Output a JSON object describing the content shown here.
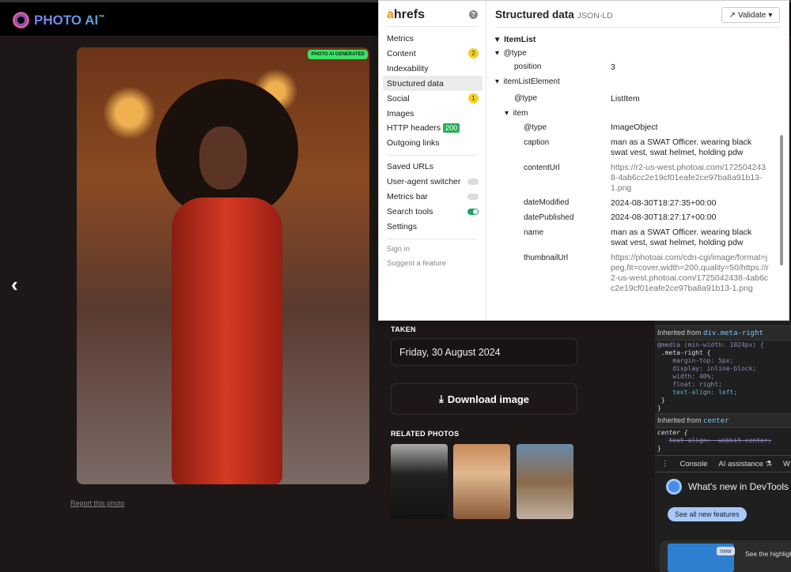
{
  "site": {
    "logo": "PHOTO AI",
    "tm": "™",
    "generated_badge": "PHOTO AI GENERATED",
    "report_link": "Report this photo",
    "taken_label": "TAKEN",
    "taken_value": "Friday, 30 August 2024",
    "download_label": "Download image",
    "related_label": "RELATED PHOTOS"
  },
  "ahrefs": {
    "brand_a": "a",
    "brand_rest": "hrefs",
    "help": "?",
    "nav": [
      {
        "label": "Metrics"
      },
      {
        "label": "Content",
        "badge": "2"
      },
      {
        "label": "Indexability"
      },
      {
        "label": "Structured data"
      },
      {
        "label": "Social",
        "badge": "1"
      },
      {
        "label": "Images"
      },
      {
        "label": "HTTP headers",
        "badge": "200"
      },
      {
        "label": "Outgoing links"
      }
    ],
    "tools": [
      {
        "label": "Saved URLs"
      },
      {
        "label": "User-agent switcher",
        "on": false
      },
      {
        "label": "Metrics bar",
        "on": false
      },
      {
        "label": "Search tools",
        "on": true
      },
      {
        "label": "Settings"
      }
    ],
    "footer": [
      "Sign in",
      "Suggest a feature"
    ],
    "title": "Structured data",
    "subtitle": "JSON-LD",
    "validate": "Validate",
    "tree": {
      "root": "ItemList",
      "type_key": "@type",
      "position_key": "position",
      "position_val": "3",
      "ile": "itemListElement",
      "ile_type": "ListItem",
      "item": "item",
      "item_type": "ImageObject",
      "caption_key": "caption",
      "caption": "man as a SWAT Officer. wearing black swat vest, swat helmet, holding pdw",
      "contentUrl_key": "contentUrl",
      "contentUrl": "https://r2-us-west.photoai.com/1725042438-4ab6cc2e19cf01eafe2ce97ba8a91b13-1.png",
      "dateModified_key": "dateModified",
      "dateModified": "2024-08-30T18:27:35+00:00",
      "datePublished_key": "datePublished",
      "datePublished": "2024-08-30T18:27:17+00:00",
      "name_key": "name",
      "name": "man as a SWAT Officer. wearing black swat vest, swat helmet, holding pdw",
      "thumbnailUrl_key": "thumbnailUrl",
      "thumbnailUrl": "https://photoai.com/cdn-cgi/image/format=jpeg,fit=cover,width=200,quality=50/https://r2-us-west.photoai.com/1725042438-4ab6cc2e19cf01eafe2ce97ba8a91b13-1.png"
    }
  },
  "devtools": {
    "inherited1": "Inherited from",
    "sel1": "div.meta-right",
    "media": "@media (min-width: 1024px) {",
    "rule": ".meta-right {",
    "props": [
      "margin-top: 5px;",
      "display: inline-block;",
      "width: 40%;",
      "float: right;",
      "text-align: left;"
    ],
    "inherited2": "Inherited from",
    "sel2": "center",
    "rule2": "center {",
    "strike": "text-align: -webkit-center;",
    "tabs": [
      "Console",
      "AI assistance ⚗",
      "W"
    ],
    "whats_new": "What's new in DevTools",
    "see_all": "See all new features",
    "new": "new",
    "highlight": "See the highlights"
  }
}
